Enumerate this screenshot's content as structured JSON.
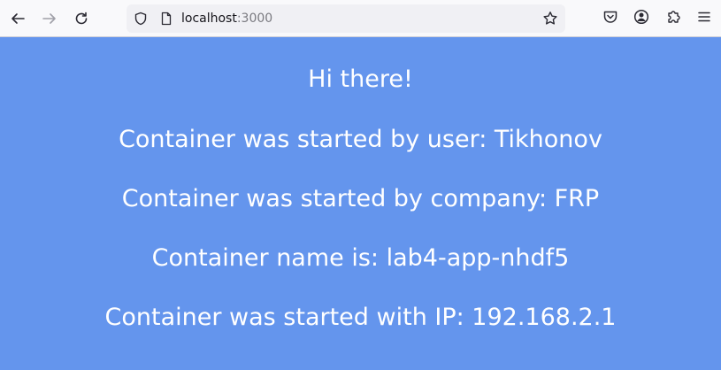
{
  "browser": {
    "url_host": "localhost",
    "url_port": ":3000",
    "icons": {
      "back": "arrow-left-icon",
      "forward": "arrow-right-icon",
      "reload": "reload-icon",
      "site_info": "shield-icon",
      "page": "page-icon",
      "bookmark": "star-icon",
      "pocket": "pocket-icon",
      "account": "account-icon",
      "extensions": "puzzle-icon",
      "menu": "hamburger-menu-icon"
    }
  },
  "page": {
    "background_color": "#6495ed",
    "text_color": "#ffffff",
    "lines": [
      "Hi there!",
      "Container was started by user: Tikhonov",
      "Container was started by company: FRP",
      "Container name is: lab4-app-nhdf5",
      "Container was started with IP: 192.168.2.1"
    ]
  }
}
